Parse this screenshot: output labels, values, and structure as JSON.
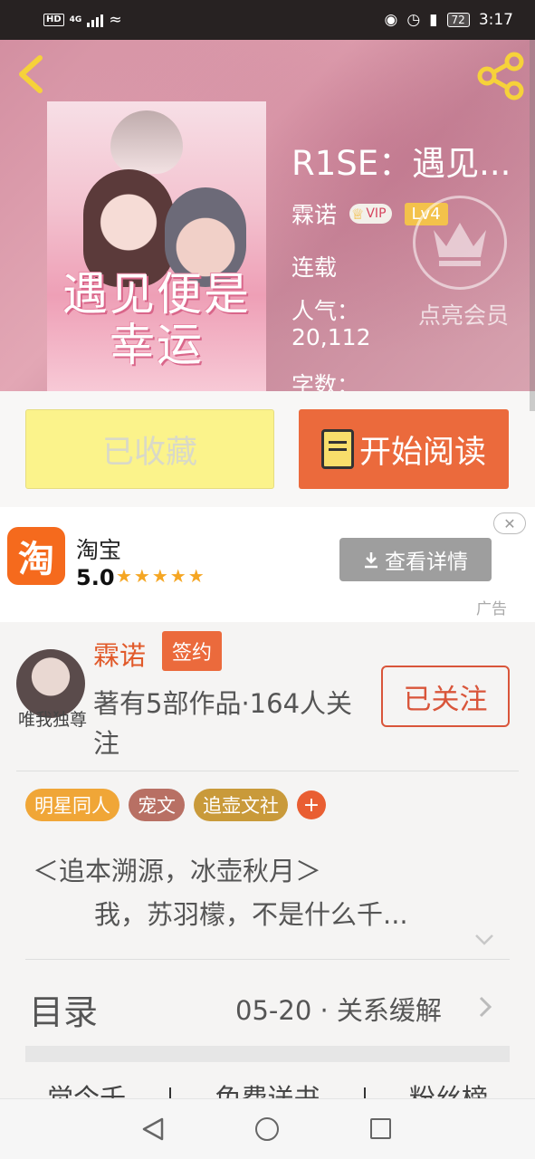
{
  "status_bar": {
    "network_badge": "HD",
    "signal_badge": "4G",
    "battery": "72",
    "time": "3:17"
  },
  "book": {
    "title": "R1SE：遇见...",
    "cover_title": "遇见便是幸运",
    "author": "霖诺",
    "vip_badge": "VIP",
    "level_badge": "Lv4",
    "status": "连载",
    "popularity_label": "人气：",
    "popularity_value": "20,112",
    "word_count_label": "字数：",
    "member_label": "点亮会员"
  },
  "actions": {
    "favorite_label": "已收藏",
    "read_label": "开始阅读"
  },
  "ad": {
    "logo_char": "淘",
    "app_name": "淘宝",
    "rating": "5.0",
    "stars": "★★★★★",
    "details_button": "查看详情",
    "ad_tag": "广告"
  },
  "writer": {
    "name": "霖诺",
    "sign_badge": "签约",
    "stats": "著有5部作品·164人关注",
    "avatar_caption": "唯我独尊",
    "follow_button": "已关注"
  },
  "tags": [
    {
      "label": "明星同人",
      "color": "#f0a637"
    },
    {
      "label": "宠文",
      "color": "#b87064"
    },
    {
      "label": "追壶文社",
      "color": "#c99a3a"
    }
  ],
  "tag_add": "+",
  "intro": {
    "line1": "＜追本溯源，冰壶秋月＞",
    "line2": "我，苏羽檬，不是什么千..."
  },
  "toc": {
    "title": "目录",
    "latest": "05-20 · 关系缓解"
  },
  "bottom_tabs": [
    "觉今千",
    "免费送书",
    "粉丝榜"
  ],
  "colors": {
    "accent": "#eb6a3c",
    "favorite_bg": "#fbf38b",
    "follow": "#d9553a"
  },
  "icons": [
    "back-arrow-icon",
    "share-icon",
    "crown-icon",
    "book-icon",
    "download-icon",
    "close-icon",
    "expand-icon",
    "chevron-right-icon"
  ]
}
